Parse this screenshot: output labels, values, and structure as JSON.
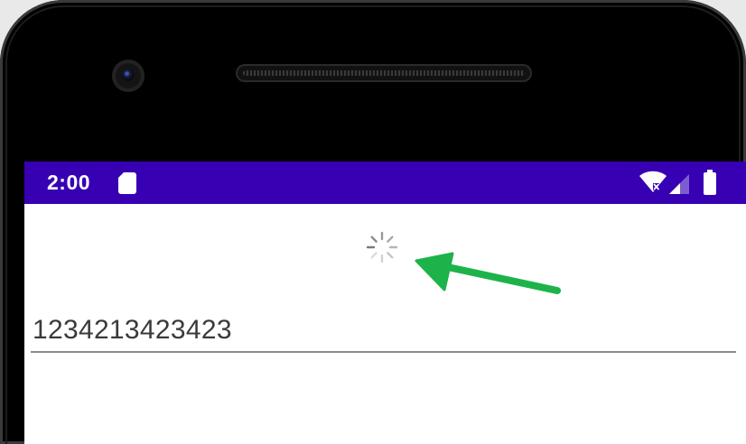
{
  "status_bar": {
    "time": "2:00",
    "sim_icon": "sim-card-icon",
    "wifi_icon": "wifi-no-internet-icon",
    "signal_icon": "cell-signal-icon",
    "battery_icon": "battery-full-icon",
    "color": "#3700b3"
  },
  "content": {
    "spinner_icon": "loading-spinner-icon",
    "text_field_value": "1234213423423",
    "annotation_arrow_color": "#1db34a"
  }
}
